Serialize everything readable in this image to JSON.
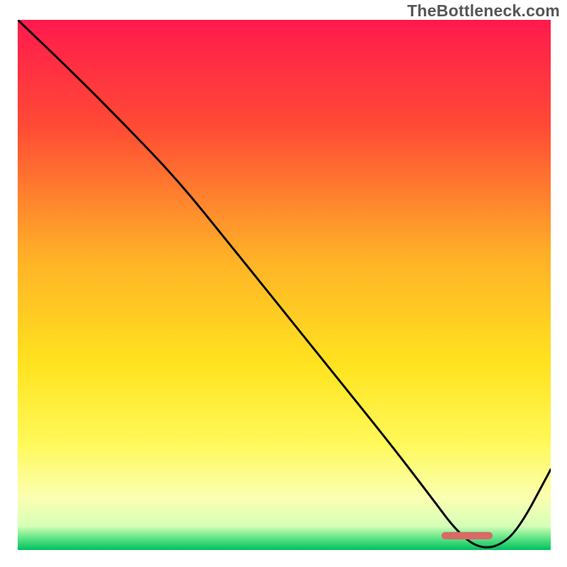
{
  "attribution": "TheBottleneck.com",
  "chart_data": {
    "type": "line",
    "title": "",
    "xlabel": "",
    "ylabel": "",
    "xlim": [
      0,
      100
    ],
    "ylim": [
      0,
      100
    ],
    "background_gradient": {
      "stops": [
        {
          "offset": 0.0,
          "color": "#ff1a4d"
        },
        {
          "offset": 0.2,
          "color": "#ff4a35"
        },
        {
          "offset": 0.45,
          "color": "#ffb227"
        },
        {
          "offset": 0.65,
          "color": "#ffe31f"
        },
        {
          "offset": 0.8,
          "color": "#fff95a"
        },
        {
          "offset": 0.9,
          "color": "#fbffb0"
        },
        {
          "offset": 0.955,
          "color": "#d6ffb8"
        },
        {
          "offset": 0.975,
          "color": "#6be88a"
        },
        {
          "offset": 1.0,
          "color": "#00c060"
        }
      ]
    },
    "series": [
      {
        "name": "curve",
        "x": [
          0,
          10,
          20,
          30,
          40,
          50,
          60,
          70,
          78,
          82,
          86,
          90,
          94,
          100
        ],
        "y": [
          100,
          90.4,
          80.3,
          69.8,
          57.4,
          44.9,
          32.4,
          19.9,
          9.4,
          4.0,
          0.5,
          0.5,
          3.9,
          15.2
        ],
        "stroke": "#000000",
        "stroke_width": 3
      }
    ],
    "marker": {
      "shape": "rounded-rect",
      "x": 79.5,
      "y": 2.0,
      "width": 9.6,
      "height": 1.4,
      "fill": "#d96a66"
    }
  }
}
